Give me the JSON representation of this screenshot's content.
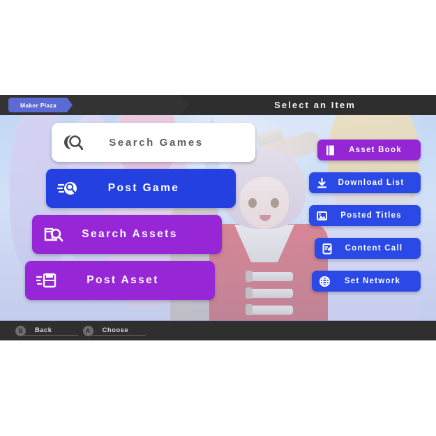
{
  "header": {
    "tab_label": "Maker Plaza",
    "title": "Select an Item"
  },
  "left_menu": [
    {
      "id": "search-games",
      "label": "Search Games",
      "icon": "game-search-icon",
      "style": "white"
    },
    {
      "id": "post-game",
      "label": "Post Game",
      "icon": "post-game-icon",
      "style": "blue"
    },
    {
      "id": "search-assets",
      "label": "Search Assets",
      "icon": "asset-search-icon",
      "style": "purple"
    },
    {
      "id": "post-asset",
      "label": "Post Asset",
      "icon": "save-disk-icon",
      "style": "purple"
    }
  ],
  "right_menu": [
    {
      "id": "asset-book",
      "label": "Asset Book",
      "icon": "book-icon",
      "style": "purple"
    },
    {
      "id": "download-list",
      "label": "Download List",
      "icon": "download-icon",
      "style": "blue"
    },
    {
      "id": "posted-titles",
      "label": "Posted Titles",
      "icon": "image-icon",
      "style": "blue"
    },
    {
      "id": "content-call",
      "label": "Content Call",
      "icon": "document-pen-icon",
      "style": "blue"
    },
    {
      "id": "set-network",
      "label": "Set Network",
      "icon": "globe-icon",
      "style": "blue"
    }
  ],
  "footer": [
    {
      "button": "B",
      "label": "Back"
    },
    {
      "button": "A",
      "label": "Choose"
    }
  ],
  "colors": {
    "blue": "#2a49e6",
    "purple": "#9626d6",
    "tab": "#5c6bd3",
    "header_bar": "#2e2e2e",
    "footer_bar": "#2f2f2f",
    "search_bar": "#ffffff",
    "search_text": "#5e5e62"
  }
}
